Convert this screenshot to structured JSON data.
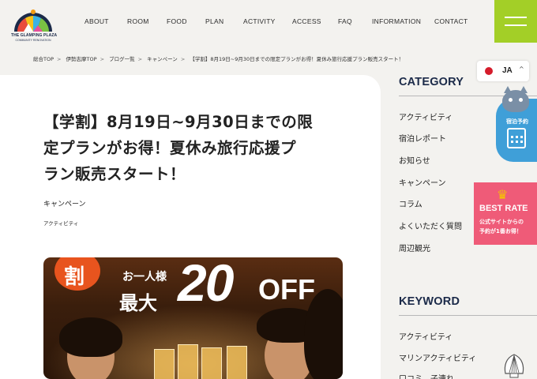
{
  "header": {
    "logo_line1": "THE GLAMPING PLAZA",
    "logo_line2": "COMMUNITY RENOVATION",
    "nav": [
      "ABOUT",
      "ROOM",
      "FOOD",
      "PLAN",
      "ACTIVITY",
      "ACCESS",
      "FAQ",
      "INFORMATION",
      "CONTACT"
    ]
  },
  "breadcrumb": [
    "総合TOP",
    "伊勢志摩TOP",
    "ブログ一覧",
    "キャンペーン",
    "【学割】8月19日~9月30日までの限定プランがお得！夏休み旅行応援プラン販売スタート！"
  ],
  "breadcrumb_sep": ">",
  "article": {
    "title_lines": [
      "【学割】8月19日~9月30日までの限",
      "定プランがお得！夏休み旅行応援プ",
      "ラン販売スタート！"
    ],
    "category": "キャンペーン",
    "tag": "アクティビティ"
  },
  "hero": {
    "badge": "割",
    "per_person": "お一人様",
    "max": "最大",
    "percent": "20",
    "off": "OFF"
  },
  "sidebar": {
    "category_heading": "CATEGORY",
    "categories": [
      "アクティビティ",
      "宿泊レポート",
      "お知らせ",
      "キャンペーン",
      "コラム",
      "よくいただく質問",
      "周辺観光"
    ],
    "keyword_heading": "KEYWORD",
    "keywords": [
      "アクティビティ",
      "マリンアクティビティ",
      "口コミ　子連れ"
    ]
  },
  "language": {
    "current": "JA",
    "chevron": "^"
  },
  "booking": {
    "label": "宿泊予約"
  },
  "best_rate": {
    "title": "BEST RATE",
    "line1": "公式サイトからの",
    "line2": "予約が1番お得！"
  },
  "colors": {
    "menu_green": "#a3cf27",
    "booking_blue": "#3f9fd8",
    "best_rate_pink": "#ef5b78",
    "heading_navy": "#1b2a49",
    "badge_orange": "#e8541e"
  },
  "icons": {
    "menu": "hamburger-icon",
    "calendar": "calendar-icon",
    "crown": "crown-icon",
    "scroll_top": "shell-icon"
  }
}
